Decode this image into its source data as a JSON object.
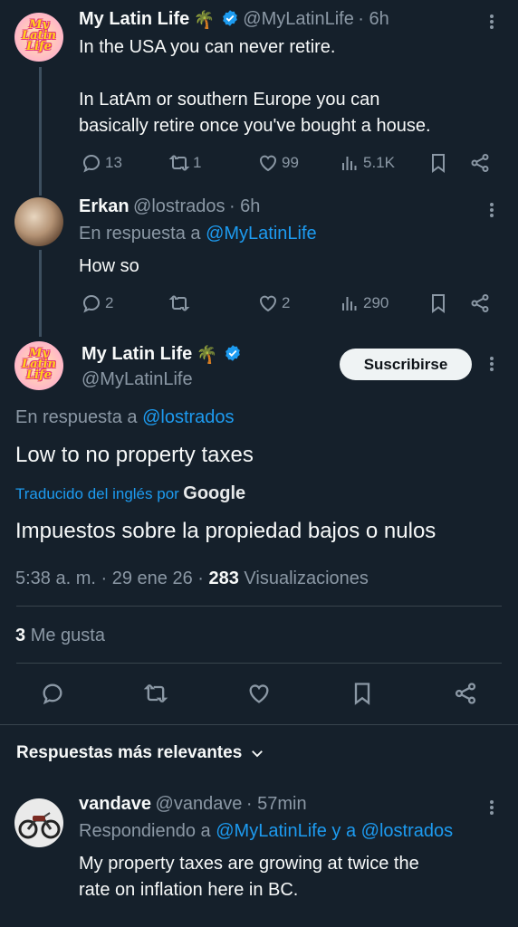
{
  "tweet1": {
    "name": "My Latin Life",
    "handle": "@MyLatinLife",
    "time": "· 6h",
    "avatar_text": "My Latin Life",
    "line1": "In the USA you can never retire.",
    "line2": "In LatAm or southern Europe you can",
    "line3": "basically retire once you've bought a house.",
    "replies": "13",
    "retweets": "1",
    "likes": "99",
    "views": "5.1K"
  },
  "tweet2": {
    "name": "Erkan",
    "handle": "@lostrados",
    "time": "· 6h",
    "reply_prefix": "En respuesta a",
    "reply_to": "@MyLatinLife",
    "text": "How so",
    "replies": "2",
    "likes": "2",
    "views": "290"
  },
  "main": {
    "name": "My Latin Life",
    "handle": "@MyLatinLife",
    "subscribe_label": "Suscribirse",
    "reply_prefix": "En respuesta a",
    "reply_to": "@lostrados",
    "text": "Low to no property taxes",
    "translated_label": "Traducido del inglés por",
    "translator": "Google",
    "translation": "Impuestos sobre la propiedad bajos o nulos",
    "time": "5:38 a. m.",
    "date": "29 ene 26",
    "views_count": "283",
    "views_label": "Visualizaciones",
    "likes_count": "3",
    "likes_label": "Me gusta"
  },
  "sort": {
    "label": "Respuestas más relevantes"
  },
  "reply": {
    "name": "vandave",
    "handle": "@vandave",
    "time": "· 57min",
    "reply_prefix": "Respondiendo a",
    "reply_to_1": "@MyLatinLife",
    "reply_joiner": "y a",
    "reply_to_2": "@lostrados",
    "line1": "My property taxes are growing at twice the",
    "line2": "rate on inflation here in BC."
  },
  "colors": {
    "background": "#15202b",
    "accent": "#1d9bf0",
    "muted": "#8b98a5",
    "divider": "#38444d"
  },
  "icons": [
    "reply-icon",
    "retweet-icon",
    "heart-icon",
    "views-icon",
    "bookmark-icon",
    "share-icon",
    "verified-icon",
    "more-icon",
    "chevron-down-icon",
    "palm-tree-icon"
  ]
}
